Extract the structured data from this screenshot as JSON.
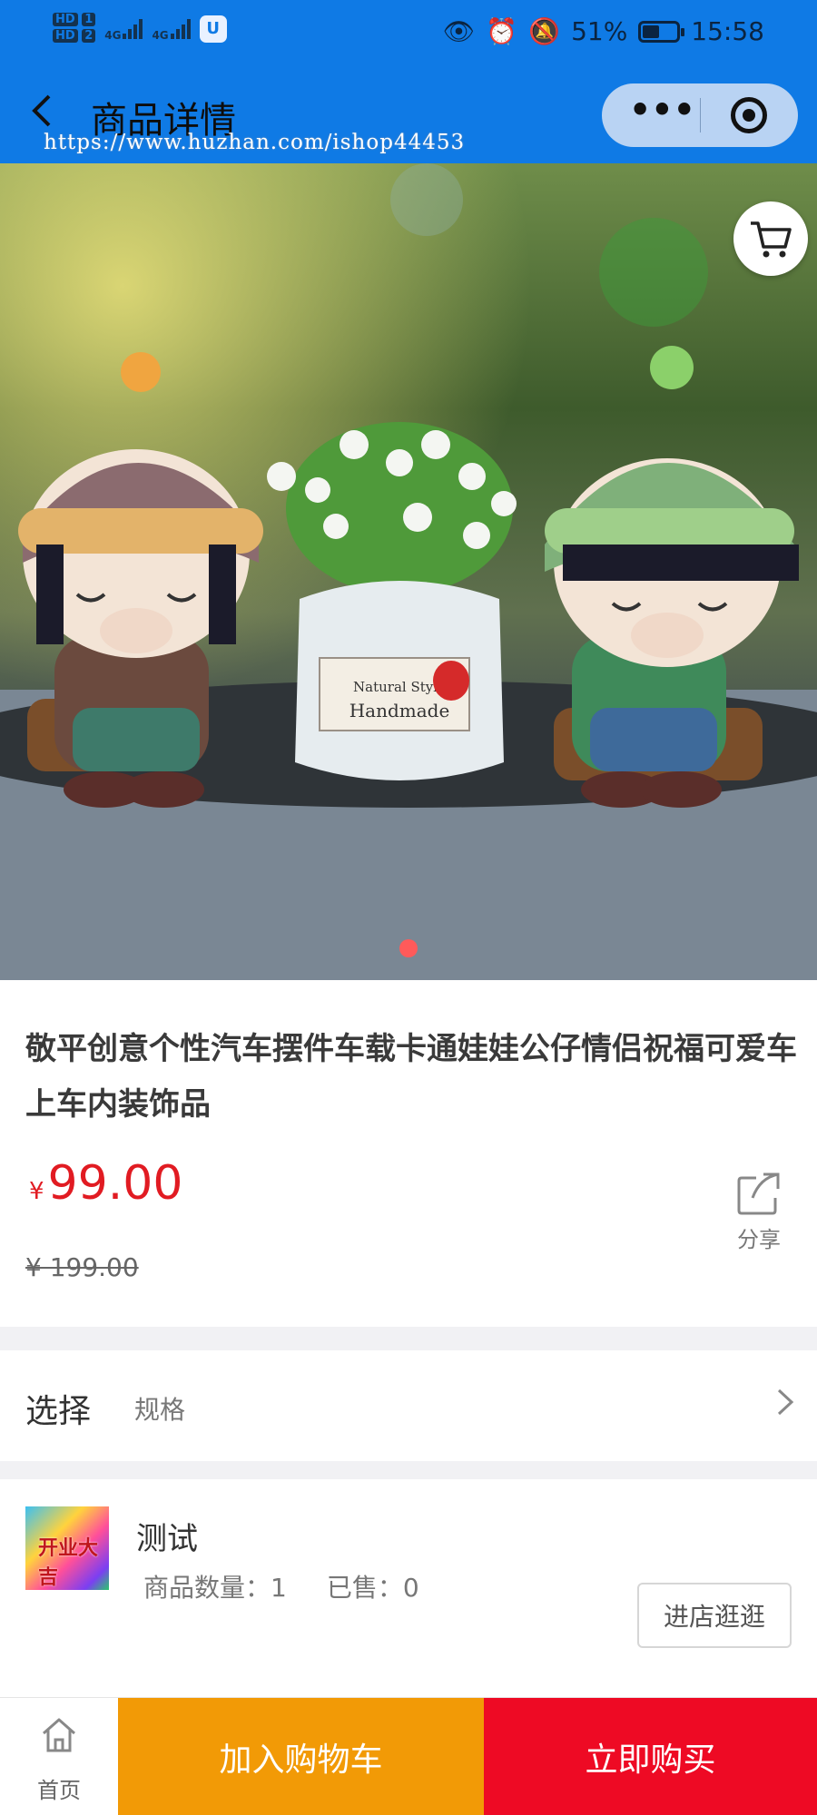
{
  "status_bar": {
    "sim1": "HD",
    "sim1_index": "1",
    "sim2": "HD",
    "sim2_index": "2",
    "network1": "4G",
    "network2": "4G",
    "battery_percent": "51%",
    "battery_level": 0.51,
    "time": "15:58"
  },
  "nav": {
    "title": "商品详情",
    "watermark": "https://www.huzhan.com/ishop44453"
  },
  "gallery": {
    "image_label": "Natural Style",
    "image_label2": "Handmade",
    "current_slide": 1,
    "slide_count": 1
  },
  "product": {
    "title": "敬平创意个性汽车摆件车载卡通娃娃公仔情侣祝福可爱车上车内装饰品",
    "currency": "¥",
    "price": "99.00",
    "original_price": "¥ 199.00",
    "share_label": "分享"
  },
  "spec": {
    "label": "选择",
    "value": "规格"
  },
  "store": {
    "name": "测试",
    "logo_text": "开业大吉",
    "quantity": "商品数量：1",
    "sold": "已售：0",
    "visit_label": "进店逛逛"
  },
  "bottom_bar": {
    "home_label": "首页",
    "add_to_cart_label": "加入购物车",
    "buy_now_label": "立即购买"
  },
  "colors": {
    "nav_bg": "#0f7ae5",
    "price": "#e11b22",
    "add_to_cart": "#f29a06",
    "buy_now": "#ee0a24"
  }
}
